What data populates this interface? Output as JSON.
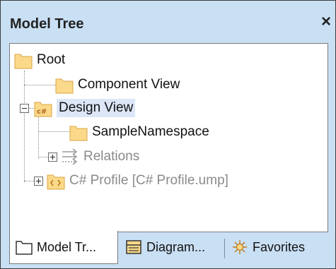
{
  "panel": {
    "title": "Model Tree",
    "close_label": "×"
  },
  "tree": {
    "root": "Root",
    "component_view": "Component View",
    "design_view": "Design View",
    "design_view_icon_text": "c#",
    "sample_namespace": "SampleNamespace",
    "relations": "Relations",
    "csharp_profile": "C# Profile [C# Profile.ump]"
  },
  "tabs": [
    {
      "label": "Model Tr...",
      "icon": "folder-icon"
    },
    {
      "label": "Diagram...",
      "icon": "diagram-tree-icon"
    },
    {
      "label": "Favorites",
      "icon": "favorites-icon"
    }
  ],
  "colors": {
    "panel_bg": "#c9dff4",
    "folder_fill": "#fbd98a",
    "folder_stroke": "#d9a441",
    "selection_bg": "#dce6f7",
    "disabled_text": "#8a8a8a"
  }
}
